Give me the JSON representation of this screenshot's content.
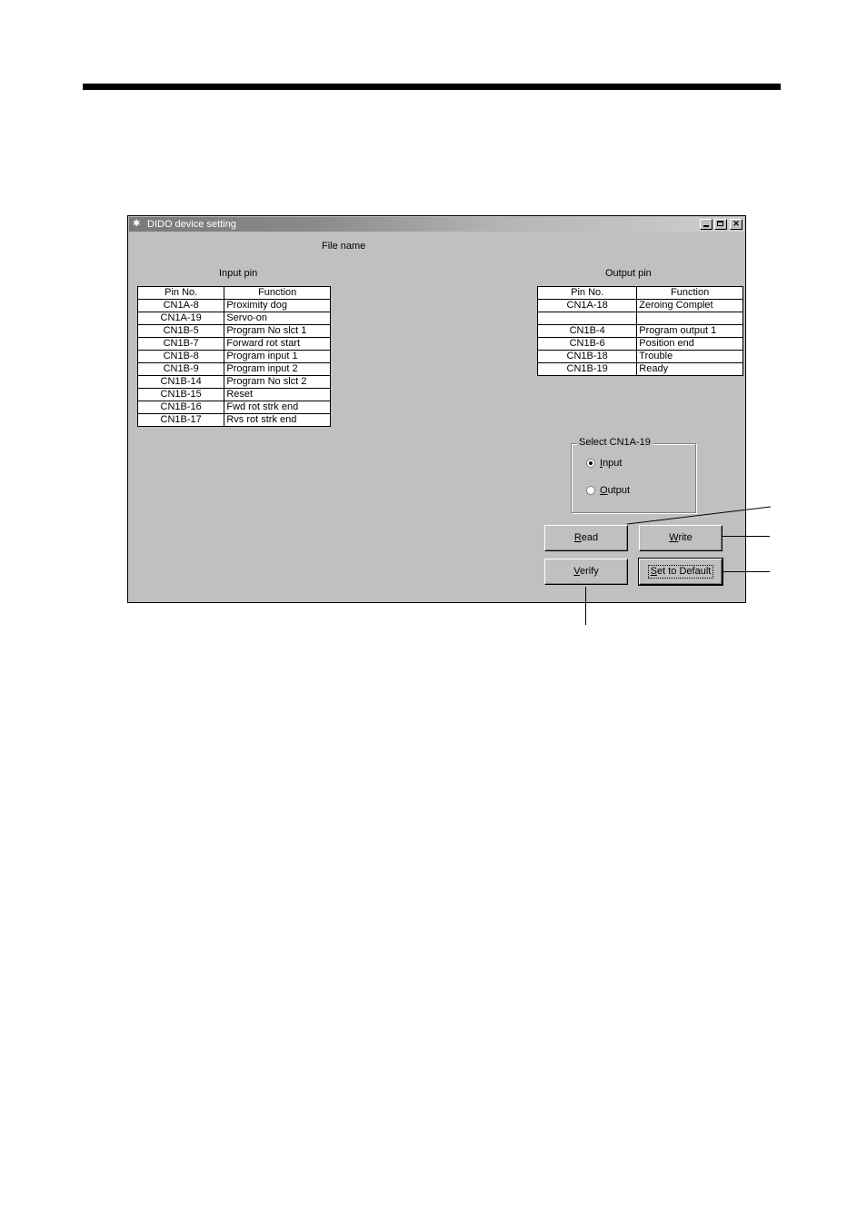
{
  "window": {
    "title": "DIDO device setting"
  },
  "file_name_label": "File name",
  "input_pin": {
    "heading": "Input pin",
    "columns": [
      "Pin No.",
      "Function"
    ],
    "rows": [
      [
        "CN1A-8",
        "Proximity  dog"
      ],
      [
        "CN1A-19",
        "Servo-on"
      ],
      [
        "CN1B-5",
        "Program No slct 1"
      ],
      [
        "CN1B-7",
        "Forward rot start"
      ],
      [
        "CN1B-8",
        "Program input 1"
      ],
      [
        "CN1B-9",
        "Program input 2"
      ],
      [
        "CN1B-14",
        "Program No slct 2"
      ],
      [
        "CN1B-15",
        "Reset"
      ],
      [
        "CN1B-16",
        "Fwd rot strk end"
      ],
      [
        "CN1B-17",
        "Rvs rot strk end"
      ]
    ]
  },
  "output_pin": {
    "heading": "Output pin",
    "columns": [
      "Pin No.",
      "Function"
    ],
    "rows": [
      [
        "CN1A-18",
        "Zeroing Complet"
      ],
      [
        "",
        ""
      ],
      [
        "CN1B-4",
        "Program output 1"
      ],
      [
        "CN1B-6",
        "Position end"
      ],
      [
        "CN1B-18",
        "Trouble"
      ],
      [
        "CN1B-19",
        "Ready"
      ]
    ]
  },
  "select_group": {
    "legend": "Select CN1A-19",
    "options": [
      {
        "label": "Input",
        "mnemonic": "I",
        "rest": "nput",
        "selected": true
      },
      {
        "label": "Output",
        "mnemonic": "O",
        "rest": "utput",
        "selected": false
      }
    ]
  },
  "buttons": {
    "read": {
      "mn": "R",
      "rest": "ead"
    },
    "write": {
      "mn": "W",
      "rest": "rite"
    },
    "verify": {
      "mn": "V",
      "rest": "erify"
    },
    "set_default": {
      "mn": "S",
      "rest": "et to Default"
    }
  }
}
